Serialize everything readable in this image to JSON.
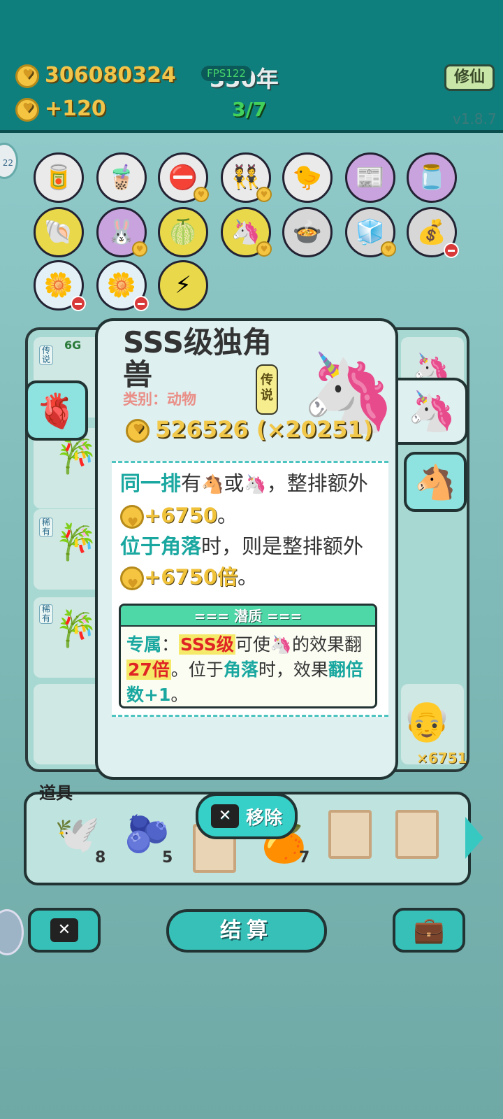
{
  "header": {
    "coins": "306080324",
    "income": "+120",
    "year": "330年",
    "fps": "FPS122",
    "round": "3/7",
    "cultivate_label": "修仙",
    "version": "v1.8.7"
  },
  "card": {
    "title": "SSS级独角兽",
    "category": "类别：动物",
    "rarity": "传说",
    "price": "526526 (×20251)",
    "desc_line1_a": "同一排",
    "desc_line1_b": "有",
    "desc_line1_c": "或",
    "desc_line1_d": "，整排额外",
    "desc_bonus1": "+6750",
    "desc_period": "。",
    "desc_line2_a": "位于角落",
    "desc_line2_b": "时，则是整排额外",
    "desc_bonus2": "+6750倍",
    "potential_title": "=== 潜质 ===",
    "pot_exclusive": "专属",
    "pot_colon": "：",
    "pot_sss": "SSS级",
    "pot_text1": "可使",
    "pot_text2": "的效果翻",
    "pot_27": "27倍",
    "pot_text3": "。位于",
    "pot_corner": "角落",
    "pot_text4": "时，效果",
    "pot_flip": "翻倍数+1",
    "pot_end": "。"
  },
  "board": {
    "cell_label_top": "6G",
    "rarity_small_1": "传说",
    "rarity_small_2": "稀有",
    "rarity_small_3": "稀有",
    "rarity_small_4": "稀有",
    "multiplier": "×6751"
  },
  "props": {
    "label": "道具",
    "counts": [
      "8",
      "5",
      "7"
    ],
    "remove_label": "移除"
  },
  "bottom": {
    "settle_label": "结算"
  },
  "colors": {
    "header_bg": "#0f7f7d",
    "accent_teal": "#36c0b8",
    "coin_gold": "#f5c542"
  }
}
